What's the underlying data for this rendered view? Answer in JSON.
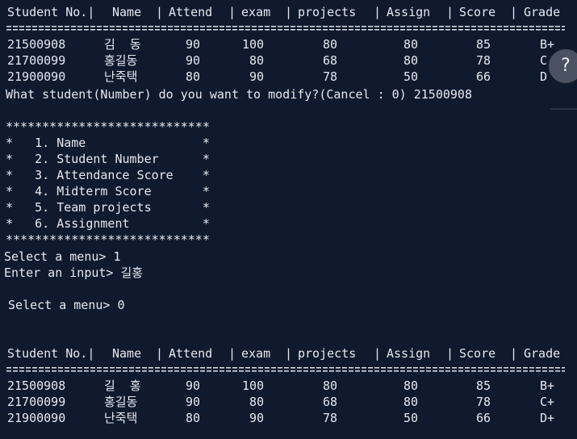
{
  "header_top": [
    "Student No.|",
    "Name",
    "|",
    "Attend",
    "|",
    "exam",
    "|",
    "projects",
    "|",
    "Assign",
    "|",
    "Score",
    "|",
    "Grade"
  ],
  "rows_before": [
    {
      "no": "21500908",
      "name": "김  동",
      "attend": "90",
      "exam": "100",
      "projects": "80",
      "assign": "80",
      "score": "85",
      "grade": "B+"
    },
    {
      "no": "21700099",
      "name": "홍길동",
      "attend": "90",
      "exam": "80",
      "projects": "68",
      "assign": "80",
      "score": "78",
      "grade": "C"
    },
    {
      "no": "21900090",
      "name": "난죽택",
      "attend": "80",
      "exam": "90",
      "projects": "78",
      "assign": "50",
      "score": "66",
      "grade": "D"
    }
  ],
  "modify_prompt": "What student(Number) do you want to modify?(Cancel : 0) 21500908",
  "menu": {
    "border": "****************************",
    "items": [
      "*   1. Name                *",
      "*   2. Student Number      *",
      "*   3. Attendance Score    *",
      "*   4. Midterm Score       *",
      "*   5. Team projects       *",
      "*   6. Assignment          *"
    ]
  },
  "select_1": "Select a menu> 1",
  "enter_input": "Enter an input> 길홍",
  "select_0": " Select a menu> 0",
  "header_bottom": [
    "Student No.|",
    "Name",
    "|",
    "Attend",
    "|",
    "exam",
    "|",
    "projects",
    "|",
    "Assign",
    "|",
    "Score",
    "|",
    "Grade"
  ],
  "rows_after": [
    {
      "no": "21500908",
      "name": "길  홍",
      "attend": "90",
      "exam": "100",
      "projects": "80",
      "assign": "80",
      "score": "85",
      "grade": "B+"
    },
    {
      "no": "21700099",
      "name": "홍길동",
      "attend": "90",
      "exam": "80",
      "projects": "68",
      "assign": "80",
      "score": "78",
      "grade": "C+"
    },
    {
      "no": "21900090",
      "name": "난죽택",
      "attend": "80",
      "exam": "90",
      "projects": "78",
      "assign": "50",
      "score": "66",
      "grade": "D+"
    }
  ],
  "help_label": "?",
  "colors": {
    "background": "#101a2e",
    "text": "#e6e8ee",
    "help_button": "#4a5160"
  }
}
